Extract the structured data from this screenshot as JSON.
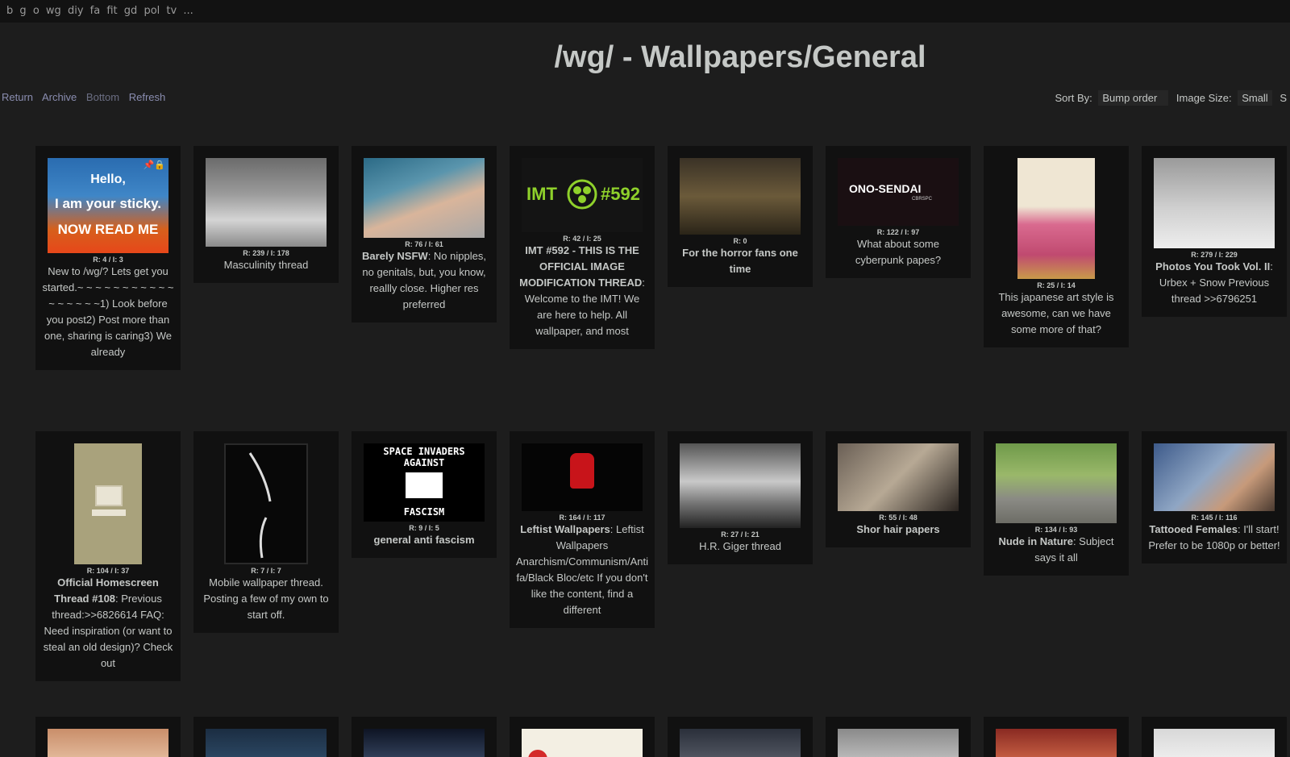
{
  "topbar": {
    "boards": [
      "b",
      "g",
      "o",
      "wg",
      "diy",
      "fa",
      "fit",
      "gd",
      "pol",
      "tv",
      "..."
    ]
  },
  "board_title": "/wg/ - Wallpapers/General",
  "nav": {
    "return": "Return",
    "archive": "Archive",
    "bottom": "Bottom",
    "refresh": "Refresh"
  },
  "sort": {
    "label": "Sort By:",
    "value": "Bump order",
    "image_size_label": "Image Size:",
    "image_size_value": "Small",
    "trailing": "S"
  },
  "threads": [
    {
      "stats": "R: 4 / I: 3",
      "subject": "",
      "text": "New to /wg/? Lets get you started.~ ~ ~ ~ ~ ~ ~ ~ ~ ~ ~ ~ ~ ~ ~ ~ ~1) Look before you post2) Post more than one, sharing is caring3) We already",
      "sticky": {
        "line1": "Hello,",
        "line2": "I am your sticky.",
        "line3": "NOW READ ME"
      }
    },
    {
      "stats": "R: 239 / I: 178",
      "subject": "",
      "text": "Masculinity thread"
    },
    {
      "stats": "R: 76 / I: 61",
      "subject": "Barely NSFW",
      "text": ": No nipples, no genitals, but, you know, reallly close. Higher res preferred"
    },
    {
      "stats": "R: 42 / I: 25",
      "subject": "IMT #592 - THIS IS THE OFFICIAL IMAGE MODIFICATION THREAD",
      "text": ": Welcome to the IMT! We are here to help. All wallpaper, and most",
      "imt": {
        "left": "IMT",
        "right": "#592"
      }
    },
    {
      "stats": "R: 0",
      "subject": "For the horror fans one time",
      "text": ""
    },
    {
      "stats": "R: 122 / I: 97",
      "subject": "",
      "text": "What about some cyberpunk papes?",
      "ono": {
        "brand": "ONO-SENDAI",
        "sub": "CBRSPC"
      }
    },
    {
      "stats": "R: 25 / I: 14",
      "subject": "",
      "text": "This japanese art style is awesome, can we have some more of that?"
    },
    {
      "stats": "R: 279 / I: 229",
      "subject": "Photos You Took Vol. II",
      "text": ": Urbex + Snow Previous thread >>6796251"
    },
    {
      "stats": "R: 104 / I: 37",
      "subject": "Official Homescreen Thread #108",
      "text": ": Previous thread:>>6826614 FAQ: Need inspiration (or want to steal an old design)? Check out"
    },
    {
      "stats": "R: 7 / I: 7",
      "subject": "",
      "text": "Mobile wallpaper thread. Posting a few of my own to start off."
    },
    {
      "stats": "R: 9 / I: 5",
      "subject": "general anti fascism",
      "text": "",
      "invaders": {
        "top": "SPACE INVADERS AGAINST",
        "bottom": "FASCISM"
      }
    },
    {
      "stats": "R: 164 / I: 117",
      "subject": "Leftist Wallpapers",
      "text": ": Leftist Wallpapers Anarchism/Communism/Antifa/Black Bloc/etc If you don't like the content, find a different"
    },
    {
      "stats": "R: 27 / I: 21",
      "subject": "",
      "text": "H.R. Giger thread"
    },
    {
      "stats": "R: 55 / I: 48",
      "subject": "Shor hair papers",
      "text": ""
    },
    {
      "stats": "R: 134 / I: 93",
      "subject": "Nude in Nature",
      "text": ": Subject says it all"
    },
    {
      "stats": "R: 145 / I: 116",
      "subject": "Tattooed Females",
      "text": ": I'll start! Prefer to be 1080p or better!"
    }
  ],
  "colors": {
    "background": "#1d1d1d",
    "card": "#111111",
    "topbar": "#121212",
    "link": "#8a8db0",
    "text": "#c5c8c6"
  }
}
